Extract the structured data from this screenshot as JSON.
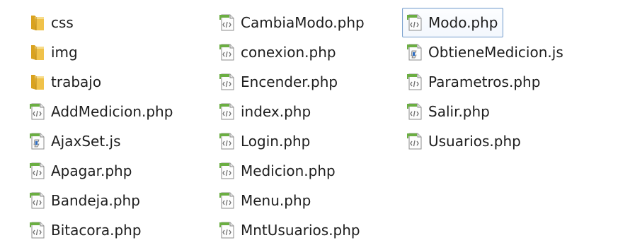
{
  "files": {
    "col1": [
      {
        "name": "css",
        "icon": "folder-icon"
      },
      {
        "name": "img",
        "icon": "folder-icon"
      },
      {
        "name": "trabajo",
        "icon": "folder-icon"
      },
      {
        "name": "AddMedicion.php",
        "icon": "php-file-icon"
      },
      {
        "name": "AjaxSet.js",
        "icon": "js-file-icon"
      },
      {
        "name": "Apagar.php",
        "icon": "php-file-icon"
      },
      {
        "name": "Bandeja.php",
        "icon": "php-file-icon"
      },
      {
        "name": "Bitacora.php",
        "icon": "php-file-icon"
      }
    ],
    "col2": [
      {
        "name": "CambiaModo.php",
        "icon": "php-file-icon"
      },
      {
        "name": "conexion.php",
        "icon": "php-file-icon"
      },
      {
        "name": "Encender.php",
        "icon": "php-file-icon"
      },
      {
        "name": "index.php",
        "icon": "php-file-icon"
      },
      {
        "name": "Login.php",
        "icon": "php-file-icon"
      },
      {
        "name": "Medicion.php",
        "icon": "php-file-icon"
      },
      {
        "name": "Menu.php",
        "icon": "php-file-icon"
      },
      {
        "name": "MntUsuarios.php",
        "icon": "php-file-icon"
      }
    ],
    "col3": [
      {
        "name": "Modo.php",
        "icon": "php-file-icon",
        "selected": true
      },
      {
        "name": "ObtieneMedicion.js",
        "icon": "js-file-icon"
      },
      {
        "name": "Parametros.php",
        "icon": "php-file-icon"
      },
      {
        "name": "Salir.php",
        "icon": "php-file-icon"
      },
      {
        "name": "Usuarios.php",
        "icon": "php-file-icon"
      }
    ]
  },
  "colors": {
    "folder": "#f0c24a",
    "folder_dark": "#d9a21f",
    "php_badge": "#6bae42",
    "selection_border": "#7da2ce"
  }
}
